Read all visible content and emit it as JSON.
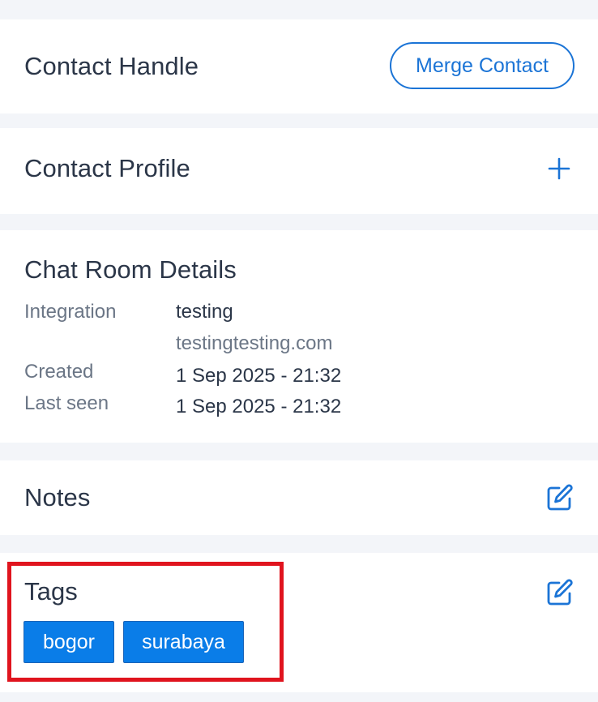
{
  "contact_handle": {
    "title": "Contact Handle",
    "merge_label": "Merge Contact"
  },
  "contact_profile": {
    "title": "Contact Profile",
    "add_icon": "plus-icon"
  },
  "chat_room": {
    "title": "Chat Room Details",
    "integration_label": "Integration",
    "integration_value": "testing",
    "integration_domain": "testingtesting.com",
    "created_label": "Created",
    "created_value": "1 Sep 2025 - 21:32",
    "last_seen_label": "Last seen",
    "last_seen_value": "1 Sep 2025 - 21:32"
  },
  "notes": {
    "title": "Notes",
    "edit_icon": "edit-icon"
  },
  "tags": {
    "title": "Tags",
    "edit_icon": "edit-icon",
    "items": [
      "bogor",
      "surabaya"
    ]
  },
  "colors": {
    "accent": "#1b74d6",
    "tag_bg": "#0a7de8",
    "highlight": "#e0141e",
    "background": "#f3f5f9"
  }
}
